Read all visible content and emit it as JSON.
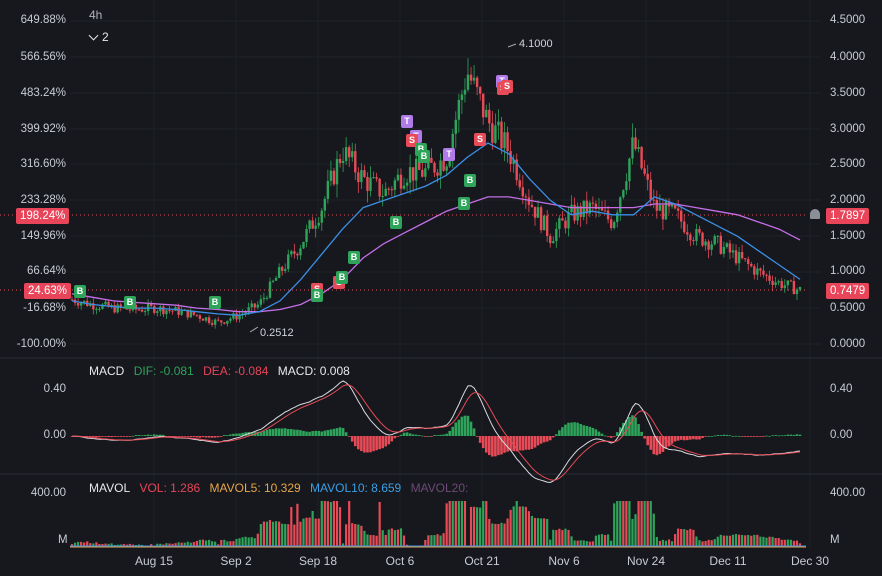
{
  "toolbar": {
    "interval": "4h",
    "collapse_label": "2"
  },
  "price_axis": {
    "left": [
      "649.88%",
      "566.56%",
      "483.24%",
      "399.92%",
      "316.60%",
      "233.28%",
      "149.96%",
      "66.64%",
      "-16.68%",
      "-100.00%"
    ],
    "right": [
      "4.5000",
      "4.0000",
      "3.5000",
      "3.0000",
      "2.5000",
      "2.0000",
      "1.5000",
      "1.0000",
      "0.5000",
      "0.0000"
    ]
  },
  "tags": {
    "ref_percent": "198.24%",
    "ref_price": "1.7897",
    "cur_percent": "24.63%",
    "cur_price": "0.7479",
    "high_label": "4.1000",
    "low_label": "0.2512"
  },
  "markers": {
    "buy": "B",
    "sell": "S",
    "take": "T"
  },
  "macd": {
    "title": "MACD",
    "dif": "DIF: -0.081",
    "dea": "DEA: -0.084",
    "macd": "MACD: 0.008",
    "axis": [
      "0.40",
      "0.00"
    ]
  },
  "mavol": {
    "title": "MAVOL",
    "vol": "VOL: 1.286",
    "mavol5": "MAVOL5: 10.329",
    "mavol10": "MAVOL10: 8.659",
    "mavol20": "MAVOL20:",
    "axis": [
      "400.00",
      "M"
    ]
  },
  "x_axis": [
    "Aug 15",
    "Sep 2",
    "Sep 18",
    "Oct 6",
    "Oct 21",
    "Nov 6",
    "Nov 24",
    "Dec 11",
    "Dec 30"
  ],
  "colors": {
    "up": "#2ea35a",
    "down": "#e84b57",
    "ma_blue": "#3b8fe6",
    "ma_purple": "#c56ee8",
    "tag_red": "#e8455a",
    "bg": "#16181d"
  },
  "chart_data": {
    "type": "candlestick",
    "y_range": [
      0,
      4.5
    ],
    "x_range": [
      "Jul 28",
      "Dec 30"
    ],
    "close_series": [
      [
        "Jul 28",
        0.62
      ],
      [
        "Aug 3",
        0.55
      ],
      [
        "Aug 9",
        0.5
      ],
      [
        "Aug 15",
        0.48
      ],
      [
        "Aug 21",
        0.5
      ],
      [
        "Aug 27",
        0.46
      ],
      [
        "Sep 2",
        0.4
      ],
      [
        "Sep 8",
        0.3
      ],
      [
        "Sep 14",
        0.4
      ],
      [
        "Sep 18",
        0.55
      ],
      [
        "Sep 24",
        1.0
      ],
      [
        "Sep 30",
        1.4
      ],
      [
        "Oct 3",
        1.9
      ],
      [
        "Oct 6",
        2.7
      ],
      [
        "Oct 9",
        2.3
      ],
      [
        "Oct 12",
        2.1
      ],
      [
        "Oct 15",
        2.4
      ],
      [
        "Oct 18",
        2.4
      ],
      [
        "Oct 21",
        2.6
      ],
      [
        "Oct 24",
        3.8
      ],
      [
        "Oct 27",
        3.1
      ],
      [
        "Oct 30",
        2.7
      ],
      [
        "Nov 2",
        2.0
      ],
      [
        "Nov 6",
        1.5
      ],
      [
        "Nov 10",
        1.8
      ],
      [
        "Nov 14",
        1.9
      ],
      [
        "Nov 18",
        1.7
      ],
      [
        "Nov 24",
        2.8
      ],
      [
        "Nov 28",
        1.9
      ],
      [
        "Dec 2",
        1.8
      ],
      [
        "Dec 6",
        1.5
      ],
      [
        "Dec 11",
        1.4
      ],
      [
        "Dec 16",
        1.2
      ],
      [
        "Dec 21",
        1.0
      ],
      [
        "Dec 26",
        0.85
      ],
      [
        "Dec 30",
        0.75
      ]
    ],
    "ma_fast": [
      0.6,
      0.55,
      0.52,
      0.5,
      0.5,
      0.48,
      0.45,
      0.42,
      0.4,
      0.45,
      0.6,
      0.9,
      1.25,
      1.6,
      1.9,
      2.0,
      2.1,
      2.2,
      2.35,
      2.6,
      2.8,
      2.65,
      2.3,
      2.0,
      1.8,
      1.85,
      1.8,
      1.8,
      2.05,
      1.95,
      1.8,
      1.65,
      1.5,
      1.3,
      1.1,
      0.9
    ],
    "ma_slow": [
      0.7,
      0.65,
      0.6,
      0.58,
      0.56,
      0.54,
      0.5,
      0.48,
      0.45,
      0.45,
      0.48,
      0.55,
      0.7,
      0.9,
      1.2,
      1.4,
      1.55,
      1.7,
      1.85,
      1.95,
      2.05,
      2.05,
      2.0,
      1.95,
      1.9,
      1.9,
      1.9,
      1.9,
      1.95,
      1.95,
      1.9,
      1.85,
      1.8,
      1.7,
      1.6,
      1.45
    ]
  }
}
